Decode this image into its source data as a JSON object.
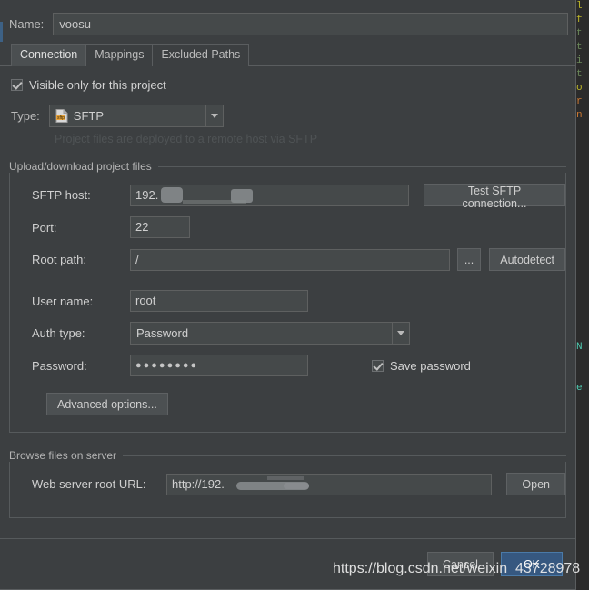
{
  "window": {
    "name_label": "Name:",
    "name_value": "voosu"
  },
  "tabs": [
    {
      "label": "Connection",
      "active": true
    },
    {
      "label": "Mappings",
      "active": false
    },
    {
      "label": "Excluded Paths",
      "active": false
    }
  ],
  "visibility": {
    "label": "Visible only for this project",
    "checked": true
  },
  "type": {
    "label": "Type:",
    "value": "SFTP",
    "icon": "sftp-file-icon",
    "hint": "Project files are deployed to a remote host via SFTP"
  },
  "upload_group": {
    "title": "Upload/download project files",
    "sftp_host": {
      "label": "SFTP host:",
      "value": "192.",
      "redacted": true
    },
    "test_button": "Test SFTP connection...",
    "port": {
      "label": "Port:",
      "value": "22"
    },
    "root_path": {
      "label": "Root path:",
      "value": "/"
    },
    "browse_button": "...",
    "autodetect_button": "Autodetect",
    "user_name": {
      "label": "User name:",
      "value": "root"
    },
    "auth_type": {
      "label": "Auth type:",
      "value": "Password"
    },
    "password": {
      "label": "Password:",
      "value": "●●●●●●●●"
    },
    "save_password": {
      "label": "Save password",
      "checked": true
    },
    "advanced_button": "Advanced options..."
  },
  "browse_group": {
    "title": "Browse files on server",
    "web_url": {
      "label": "Web server root URL:",
      "value": "http://192.",
      "redacted": true
    },
    "open_button": "Open"
  },
  "footer": {
    "cancel_button": "Cancel",
    "ok_button": "OK"
  },
  "watermark": {
    "text": "https://blog.csdn.net/weixin_43728978"
  },
  "colors": {
    "dialog_bg": "#3c3f41",
    "field_bg": "#45494a",
    "accent_blue": "#365880",
    "text": "#d0d0d0"
  },
  "background_editor": {
    "lines": [
      "l",
      "f",
      "t",
      "t",
      "i",
      "t",
      "o",
      "r",
      "n",
      "",
      "",
      "",
      "",
      "",
      "",
      "",
      "",
      "",
      "",
      "N",
      "",
      "e"
    ]
  }
}
